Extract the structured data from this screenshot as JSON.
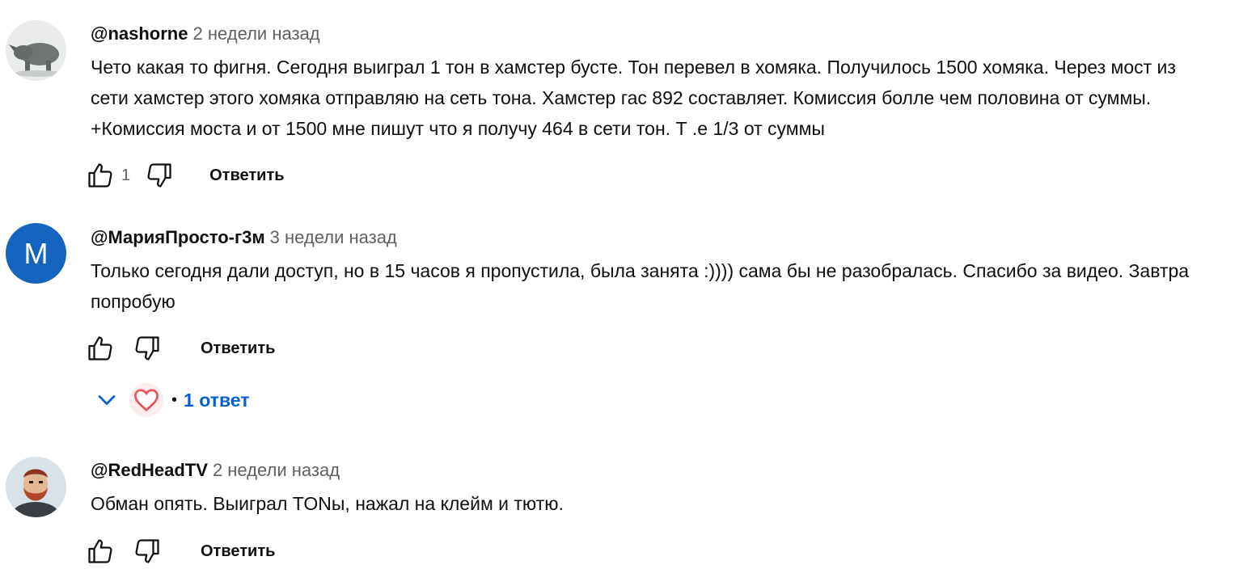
{
  "comments": [
    {
      "author": "@nashorne",
      "time": "2 недели назад",
      "text": "Чето какая то фигня. Сегодня выиграл 1 тон в хамстер бусте. Тон перевел в хомяка. Получилось 1500 хомяка. Через мост из сети хамстер этого хомяка отправляю на сеть тона. Хамстер гас 892 составляет. Комиссия болле чем половина от суммы. +Комиссия моста и от 1500 мне пишут что я получу 464 в сети тон. Т .е 1/3 от суммы",
      "likes": "1",
      "reply_label": "Ответить",
      "avatar_icon": "rhino-avatar"
    },
    {
      "author": "@МарияПросто-г3м",
      "time": "3 недели назад",
      "text": "Только сегодня дали доступ, но в 15 часов я пропустила, была занята :)))) сама бы не разобралась. Спасибо за видео. Завтра попробую",
      "likes": "",
      "reply_label": "Ответить",
      "avatar_letter": "M",
      "avatar_color": "#1565c0",
      "replies_label": "1 ответ",
      "replies_dot": "•"
    },
    {
      "author": "@RedHeadTV",
      "time": "2 недели назад",
      "text": "Обман опять. Выиграл TONы, нажал на клейм и тютю.",
      "likes": "",
      "reply_label": "Ответить",
      "avatar_icon": "bearded-man-avatar"
    }
  ]
}
